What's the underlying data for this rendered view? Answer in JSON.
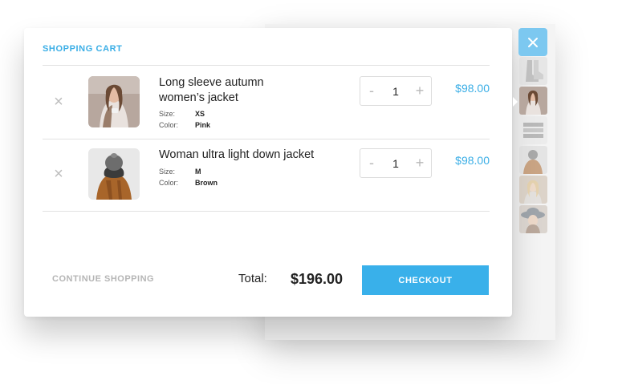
{
  "cart": {
    "title": "SHOPPING CART",
    "items": [
      {
        "name_line1": "Long sleeve autumn",
        "name_line2": "women’s jacket",
        "size_label": "Size:",
        "size_value": "XS",
        "color_label": "Color:",
        "color_value": "Pink",
        "qty_minus": "-",
        "quantity": "1",
        "qty_plus": "+",
        "price": "$98.00"
      },
      {
        "name_line1": "Woman ultra light down jacket",
        "name_line2": "",
        "size_label": "Size:",
        "size_value": "M",
        "color_label": "Color:",
        "color_value": "Brown",
        "qty_minus": "-",
        "quantity": "1",
        "qty_plus": "+",
        "price": "$98.00"
      }
    ],
    "continue_label": "CONTINUE SHOPPING",
    "total_label": "Total:",
    "total_value": "$196.00",
    "checkout_label": "CHECKOUT"
  },
  "colors": {
    "accent": "#39b0ea",
    "close_button": "#7cc8f0",
    "muted_text": "#b5b5b5"
  },
  "icons": {
    "remove": "close-x-icon",
    "close": "close-x-icon"
  }
}
